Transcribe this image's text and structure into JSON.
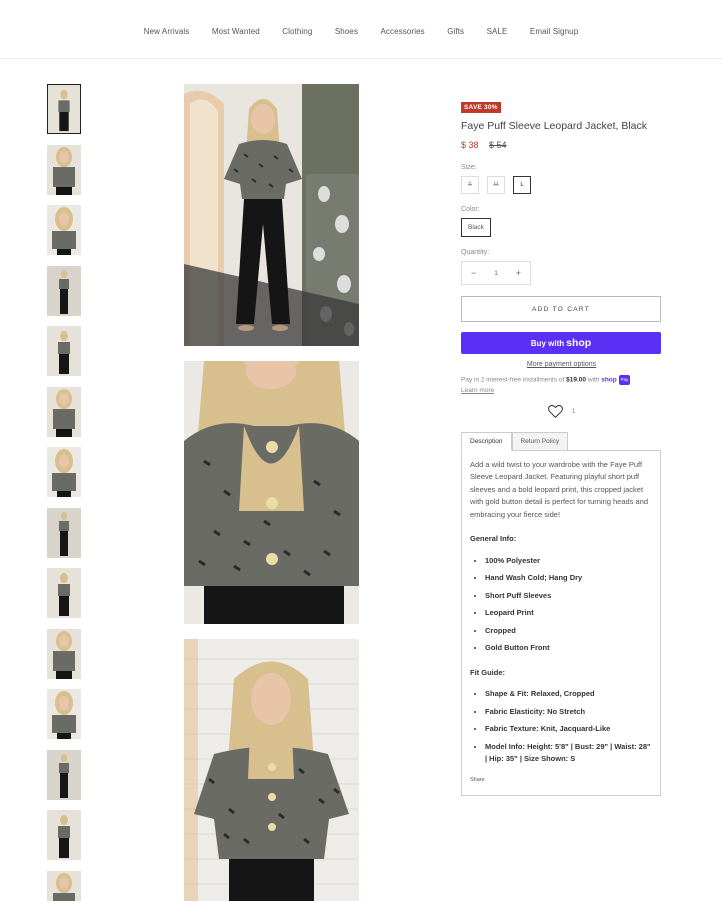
{
  "nav": {
    "items": [
      "New Arrivals",
      "Most Wanted",
      "Clothing",
      "Shoes",
      "Accessories",
      "Gifts",
      "SALE",
      "Email Signup"
    ]
  },
  "gallery": {
    "thumbnail_count": 14,
    "selected_index": 0,
    "photo_count": 3
  },
  "product": {
    "badge": "SAVE 30%",
    "title": "Faye Puff Sleeve Leopard Jacket, Black",
    "price_sale": "$ 38",
    "price_old": "$ 54",
    "size_label": "Size:",
    "sizes": [
      "S",
      "M",
      "L"
    ],
    "selected_size": "L",
    "color_label": "Color:",
    "color_value": "Black",
    "quantity_label": "Quantity:",
    "quantity_value": "1",
    "minus": "−",
    "plus": "+",
    "add_to_cart": "ADD TO CART",
    "shop_pay_prefix": "Buy with",
    "shop_pay_word": "shop",
    "more_payment": "More payment options",
    "installments_text": "Pay in 2 interest-free installments of",
    "installments_amount": "$19.00",
    "installments_with": "with",
    "installments_shop": "shop",
    "installments_pay": "Pay",
    "learn_more": "Learn more",
    "wishlist_count": "1"
  },
  "tabs": [
    {
      "label": "Description",
      "active": true
    },
    {
      "label": "Return Policy",
      "active": false
    }
  ],
  "description": {
    "intro": "Add a wild twist to your wardrobe with the Faye Puff Sleeve Leopard Jacket. Featuring playful short puff sleeves and a bold leopard print, this cropped jacket with gold button detail is perfect for turning heads and embracing your fierce side!",
    "general_heading": "General Info:",
    "general_items": [
      "100% Polyester",
      "Hand Wash Cold; Hang Dry",
      "Short Puff Sleeves",
      "Leopard Print",
      "Cropped",
      "Gold Button Front"
    ],
    "fit_heading": "Fit Guide:",
    "fit_items": [
      "Shape & Fit: Relaxed, Cropped",
      "Fabric Elasticity: No Stretch",
      "Fabric Texture: Knit, Jacquard-Like",
      "Model Info: Height: 5'8\" | Bust: 29\" | Waist: 28\" | Hip: 35\" | Size Shown: S"
    ],
    "share": "Share"
  },
  "colors": {
    "sale_red": "#c0392b",
    "shop_purple": "#5a31f4",
    "leopard_base": "#6b6b66",
    "hair": "#d8bf8e",
    "skin": "#e8c4a8"
  }
}
